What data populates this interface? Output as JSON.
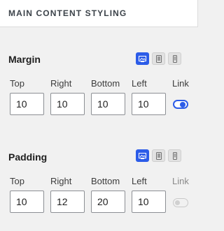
{
  "header": {
    "title": "MAIN CONTENT STYLING"
  },
  "colors": {
    "accent": "#2c5ce8",
    "panel_bg": "#f1f1f1",
    "header_bg": "#ffffff"
  },
  "margin": {
    "title": "Margin",
    "devices": [
      {
        "name": "desktop-icon",
        "active": true
      },
      {
        "name": "tablet-icon",
        "active": false
      },
      {
        "name": "mobile-icon",
        "active": false
      }
    ],
    "labels": {
      "top": "Top",
      "right": "Right",
      "bottom": "Bottom",
      "left": "Left",
      "link": "Link"
    },
    "values": {
      "top": "10",
      "right": "10",
      "bottom": "10",
      "left": "10"
    },
    "linked": true
  },
  "padding": {
    "title": "Padding",
    "devices": [
      {
        "name": "desktop-icon",
        "active": true
      },
      {
        "name": "tablet-icon",
        "active": false
      },
      {
        "name": "mobile-icon",
        "active": false
      }
    ],
    "labels": {
      "top": "Top",
      "right": "Right",
      "bottom": "Bottom",
      "left": "Left",
      "link": "Link"
    },
    "values": {
      "top": "10",
      "right": "12",
      "bottom": "20",
      "left": "10"
    },
    "linked": false
  }
}
